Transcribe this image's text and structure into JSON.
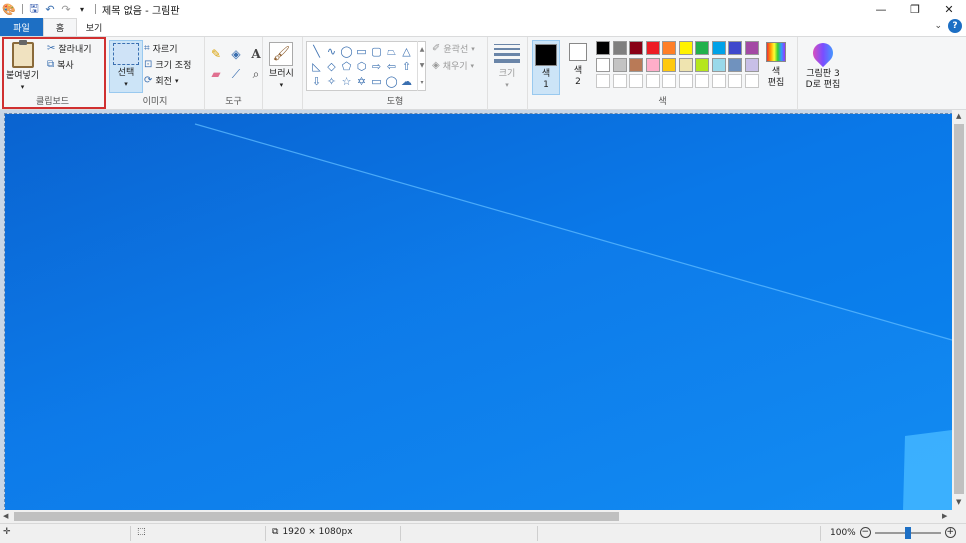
{
  "title_bar": {
    "title": "제목 없음 - 그림판",
    "qat_icons": [
      "paint-app-icon",
      "save-icon",
      "undo-icon",
      "redo-icon",
      "customize-qat-icon"
    ],
    "window_buttons": {
      "minimize": "—",
      "restore": "❐",
      "close": "✕"
    }
  },
  "tabs": {
    "file": "파일",
    "home": "홈",
    "view": "보기",
    "help": "?"
  },
  "ribbon": {
    "clipboard": {
      "label": "클립보드",
      "paste": "붙여넣기",
      "cut": "잘라내기",
      "copy": "복사"
    },
    "image": {
      "label": "이미지",
      "select": "선택",
      "crop": "자르기",
      "resize": "크기 조정",
      "rotate": "회전"
    },
    "tools": {
      "label": "도구"
    },
    "brushes": {
      "label": "브러시"
    },
    "shapes": {
      "label": "도형",
      "outline": "윤곽선",
      "fill": "채우기"
    },
    "size": {
      "label": "크기"
    },
    "colors": {
      "label": "색",
      "color1_line1": "색",
      "color1_line2": "1",
      "color2_line1": "색",
      "color2_line2": "2",
      "edit_line1": "색",
      "edit_line2": "편집",
      "color1_value": "#000000",
      "color2_value": "#ffffff",
      "palette": [
        "#000000",
        "#7f7f7f",
        "#880015",
        "#ed1c24",
        "#ff7f27",
        "#fff200",
        "#22b14c",
        "#00a2e8",
        "#3f48cc",
        "#a349a4",
        "#ffffff",
        "#c3c3c3",
        "#b97a57",
        "#ffaec9",
        "#ffc90e",
        "#efe4b0",
        "#b5e61d",
        "#99d9ea",
        "#7092be",
        "#c8bfe7"
      ]
    },
    "paint3d": {
      "line1": "그림판 3",
      "line2": "D로 편집"
    }
  },
  "status_bar": {
    "canvas_size": "1920 × 1080px",
    "zoom": "100%",
    "zoom_level": 0.5
  }
}
